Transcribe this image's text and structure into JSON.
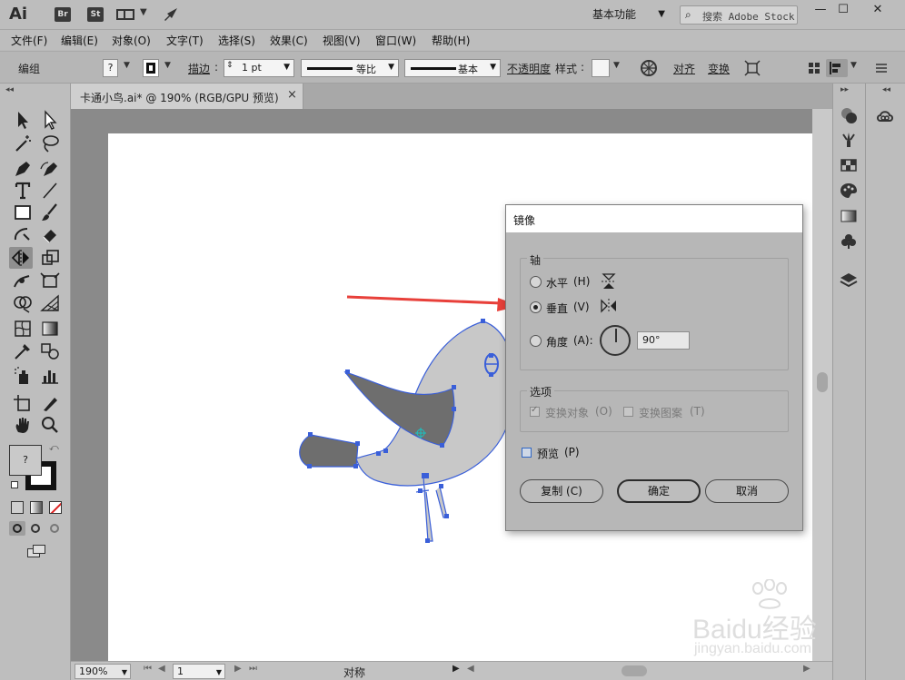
{
  "titlebar": {
    "app_logo": "Ai",
    "bridge_badge": "Br",
    "stock_badge": "St",
    "workspace": "基本功能",
    "search_placeholder": "搜索 Adobe Stock",
    "icons": [
      "workspace-layout-icon",
      "publish-rocket-icon",
      "search-icon",
      "minimize-icon",
      "maximize-icon",
      "close-icon"
    ]
  },
  "menubar": [
    "文件(F)",
    "编辑(E)",
    "对象(O)",
    "文字(T)",
    "选择(S)",
    "效果(C)",
    "视图(V)",
    "窗口(W)",
    "帮助(H)"
  ],
  "controlbar": {
    "selection_label": "编组",
    "fill_value": "?",
    "stroke_label": "描边",
    "stroke_weight": "1 pt",
    "stroke_profile": "等比",
    "brush_definition": "基本",
    "opacity_label": "不透明度",
    "style_label": "样式",
    "align_label": "对齐",
    "transform_label": "变换"
  },
  "document": {
    "tab_title": "卡通小鸟.ai* @ 190% (RGB/GPU 预览)",
    "close_glyph": "×"
  },
  "toolbar": {
    "fill_stroke_value": "?"
  },
  "statusbar": {
    "zoom": "190%",
    "artboard_number": "1",
    "status_text": "对称"
  },
  "dialog": {
    "title": "镜像",
    "axis_group": "轴",
    "horizontal_label": "水平",
    "horizontal_key": "(H)",
    "vertical_label": "垂直",
    "vertical_key": "(V)",
    "angle_label": "角度",
    "angle_key": "(A):",
    "angle_value": "90°",
    "selected_axis": "vertical",
    "options_group": "选项",
    "transform_objects_label": "变换对象",
    "transform_objects_key": "(O)",
    "transform_objects_checked": true,
    "transform_patterns_label": "变换图案",
    "transform_patterns_key": "(T)",
    "transform_patterns_checked": false,
    "preview_label": "预览",
    "preview_key": "(P)",
    "preview_checked": false,
    "copy_button": "复制",
    "copy_key": "(C)",
    "ok_button": "确定",
    "cancel_button": "取消"
  },
  "colors": {
    "arrow": "#e8403a",
    "selection_blue": "#3a5fd9",
    "bird_body": "#c8c8c8",
    "bird_wing": "#6e6e6e"
  },
  "watermark": {
    "brand": "Baidu经验",
    "url": "jingyan.baidu.com"
  }
}
